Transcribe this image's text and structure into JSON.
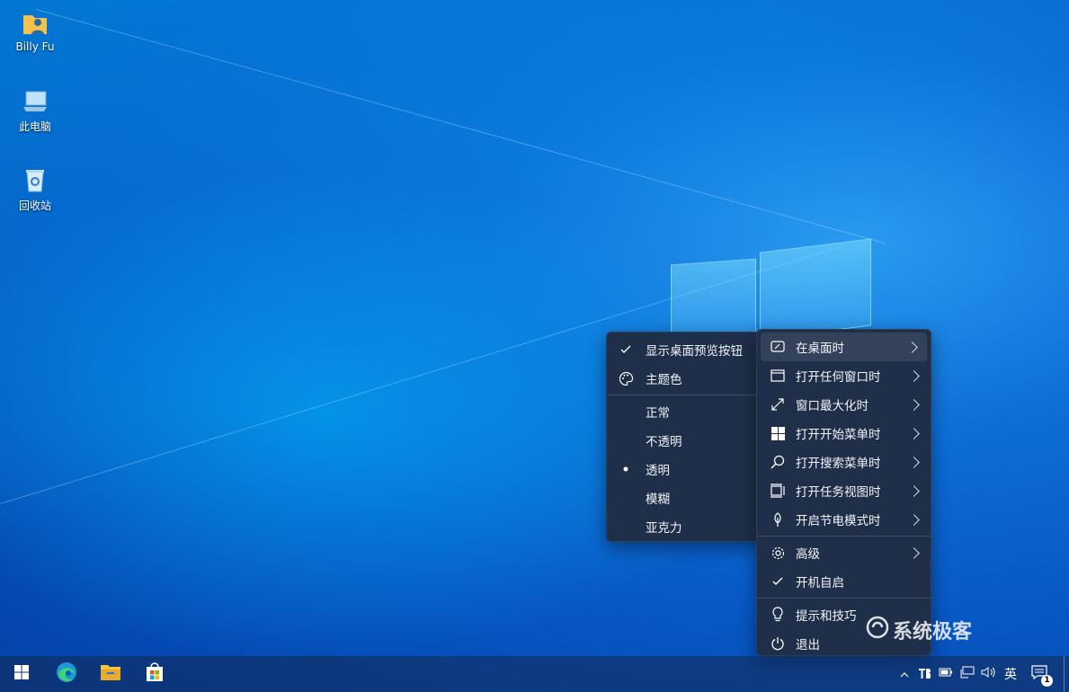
{
  "desktop": {
    "icons": [
      {
        "label": "Billy Fu",
        "icon": "user-folder-icon"
      },
      {
        "label": "此电脑",
        "icon": "computer-icon"
      },
      {
        "label": "回收站",
        "icon": "recycle-bin-icon"
      }
    ]
  },
  "menu_left": {
    "items": [
      {
        "label": "显示桌面预览按钮",
        "icon": "checkmark-icon",
        "checked": true
      },
      {
        "label": "主题色",
        "icon": "palette-icon"
      }
    ],
    "styles": [
      {
        "label": "正常"
      },
      {
        "label": "不透明"
      },
      {
        "label": "透明",
        "selected": true
      },
      {
        "label": "模糊"
      },
      {
        "label": "亚克力"
      }
    ]
  },
  "menu_right": {
    "items": [
      {
        "label": "在桌面时",
        "icon": "desktop-icon",
        "submenu": true
      },
      {
        "label": "打开任何窗口时",
        "icon": "window-icon",
        "submenu": true
      },
      {
        "label": "窗口最大化时",
        "icon": "maximize-icon",
        "submenu": true
      },
      {
        "label": "打开开始菜单时",
        "icon": "windows-logo-icon",
        "submenu": true
      },
      {
        "label": "打开搜索菜单时",
        "icon": "search-icon",
        "submenu": true
      },
      {
        "label": "打开任务视图时",
        "icon": "task-view-icon",
        "submenu": true
      },
      {
        "label": "开启节电模式时",
        "icon": "leaf-icon",
        "submenu": true
      }
    ],
    "items2": [
      {
        "label": "高级",
        "icon": "gear-icon",
        "submenu": true
      },
      {
        "label": "开机自启",
        "icon": "checkmark-icon",
        "checked": true
      }
    ],
    "items3": [
      {
        "label": "提示和技巧",
        "icon": "lightbulb-icon"
      },
      {
        "label": "退出",
        "icon": "power-icon"
      }
    ]
  },
  "taskbar": {
    "apps": [
      "start-icon",
      "edge-icon",
      "file-explorer-icon",
      "store-icon"
    ],
    "tray": {
      "ime": "英",
      "notification_count": "1"
    }
  },
  "watermark": {
    "text": "系统极客"
  },
  "colors": {
    "menu_bg": "#1f2f4a",
    "desktop": "#0b6bd6"
  }
}
